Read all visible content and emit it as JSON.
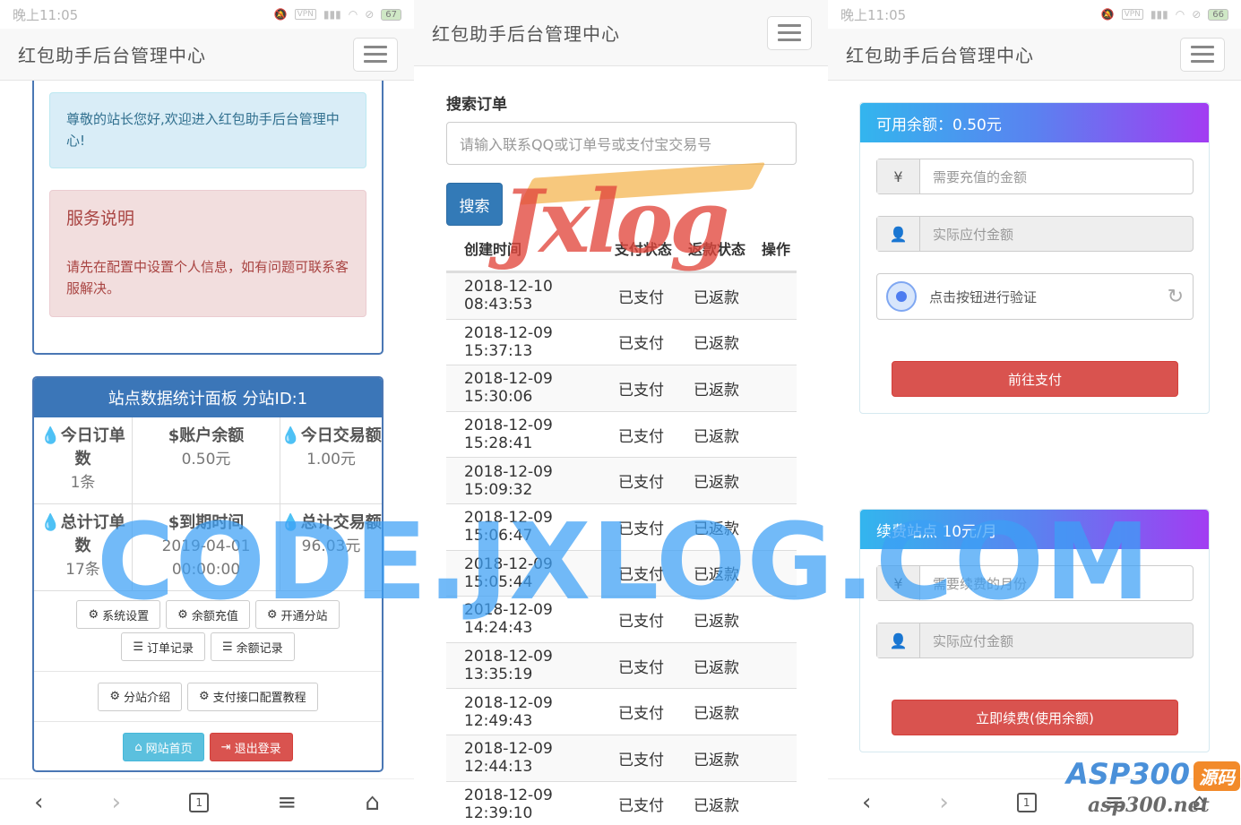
{
  "statusbar": {
    "time": "晚上11:05",
    "vpn": "VPN",
    "battery_left": "67",
    "battery_right": "66"
  },
  "brand": "红包助手后台管理中心",
  "panel1": {
    "welcome": "尊敬的站长您好,欢迎进入红包助手后台管理中心!",
    "service_title": "服务说明",
    "service_text": "请先在配置中设置个人信息，如有问题可联系客服解决。",
    "stats_title": "站点数据统计面板 分站ID:1",
    "stats": [
      {
        "icon": "💧",
        "label": "今日订单数",
        "value": "1条"
      },
      {
        "icon": "$",
        "label": "账户余额",
        "value": "0.50元"
      },
      {
        "icon": "💧",
        "label": "今日交易额",
        "value": "1.00元"
      },
      {
        "icon": "💧",
        "label": "总计订单数",
        "value": "17条"
      },
      {
        "icon": "$",
        "label": "到期时间",
        "value": "2019-04-01 00:00:00"
      },
      {
        "icon": "💧",
        "label": "总计交易额",
        "value": "96.03元"
      }
    ],
    "buttons": {
      "sys_settings": "系统设置",
      "recharge": "余额充值",
      "open_sub": "开通分站",
      "order_records": "订单记录",
      "balance_records": "余额记录",
      "sub_intro": "分站介绍",
      "pay_tutorial": "支付接口配置教程",
      "home": "网站首页",
      "logout": "退出登录"
    }
  },
  "panel2": {
    "search_title": "搜索订单",
    "search_placeholder": "请输入联系QQ或订单号或支付宝交易号",
    "search_button": "搜索",
    "columns": [
      "创建时间",
      "支付状态",
      "返款状态",
      "操作"
    ],
    "rows": [
      [
        "2018-12-10 08:43:53",
        "已支付",
        "已返款"
      ],
      [
        "2018-12-09 15:37:13",
        "已支付",
        "已返款"
      ],
      [
        "2018-12-09 15:30:06",
        "已支付",
        "已返款"
      ],
      [
        "2018-12-09 15:28:41",
        "已支付",
        "已返款"
      ],
      [
        "2018-12-09 15:09:32",
        "已支付",
        "已返款"
      ],
      [
        "2018-12-09 15:06:47",
        "已支付",
        "已返款"
      ],
      [
        "2018-12-09 15:05:44",
        "已支付",
        "已返款"
      ],
      [
        "2018-12-09 14:24:43",
        "已支付",
        "已返款"
      ],
      [
        "2018-12-09 13:35:19",
        "已支付",
        "已返款"
      ],
      [
        "2018-12-09 12:49:43",
        "已支付",
        "已返款"
      ],
      [
        "2018-12-09 12:44:13",
        "已支付",
        "已返款"
      ],
      [
        "2018-12-09 12:39:10",
        "已支付",
        "已返款"
      ]
    ]
  },
  "panel3": {
    "balance_title": "可用余额：0.50元",
    "recharge_placeholder": "需要充值的金额",
    "pay_amount": "实际应付金额",
    "verify_text": "点击按钮进行验证",
    "go_pay": "前往支付",
    "renew_title": "续费站点 10元/月",
    "renew_placeholder": "需要续费的月份",
    "renew_pay_amount": "实际应付金额",
    "renew_button": "立即续费(使用余额)"
  },
  "watermarks": {
    "big": "CODE.JXLOG.COM",
    "jxlog": "Jxlog",
    "asp": "ASP300",
    "asp_tag": "源码",
    "asp_sub": "asp300.net"
  },
  "colors": {
    "primary": "#337ab7",
    "danger": "#d9534f",
    "info": "#5bc0de"
  }
}
